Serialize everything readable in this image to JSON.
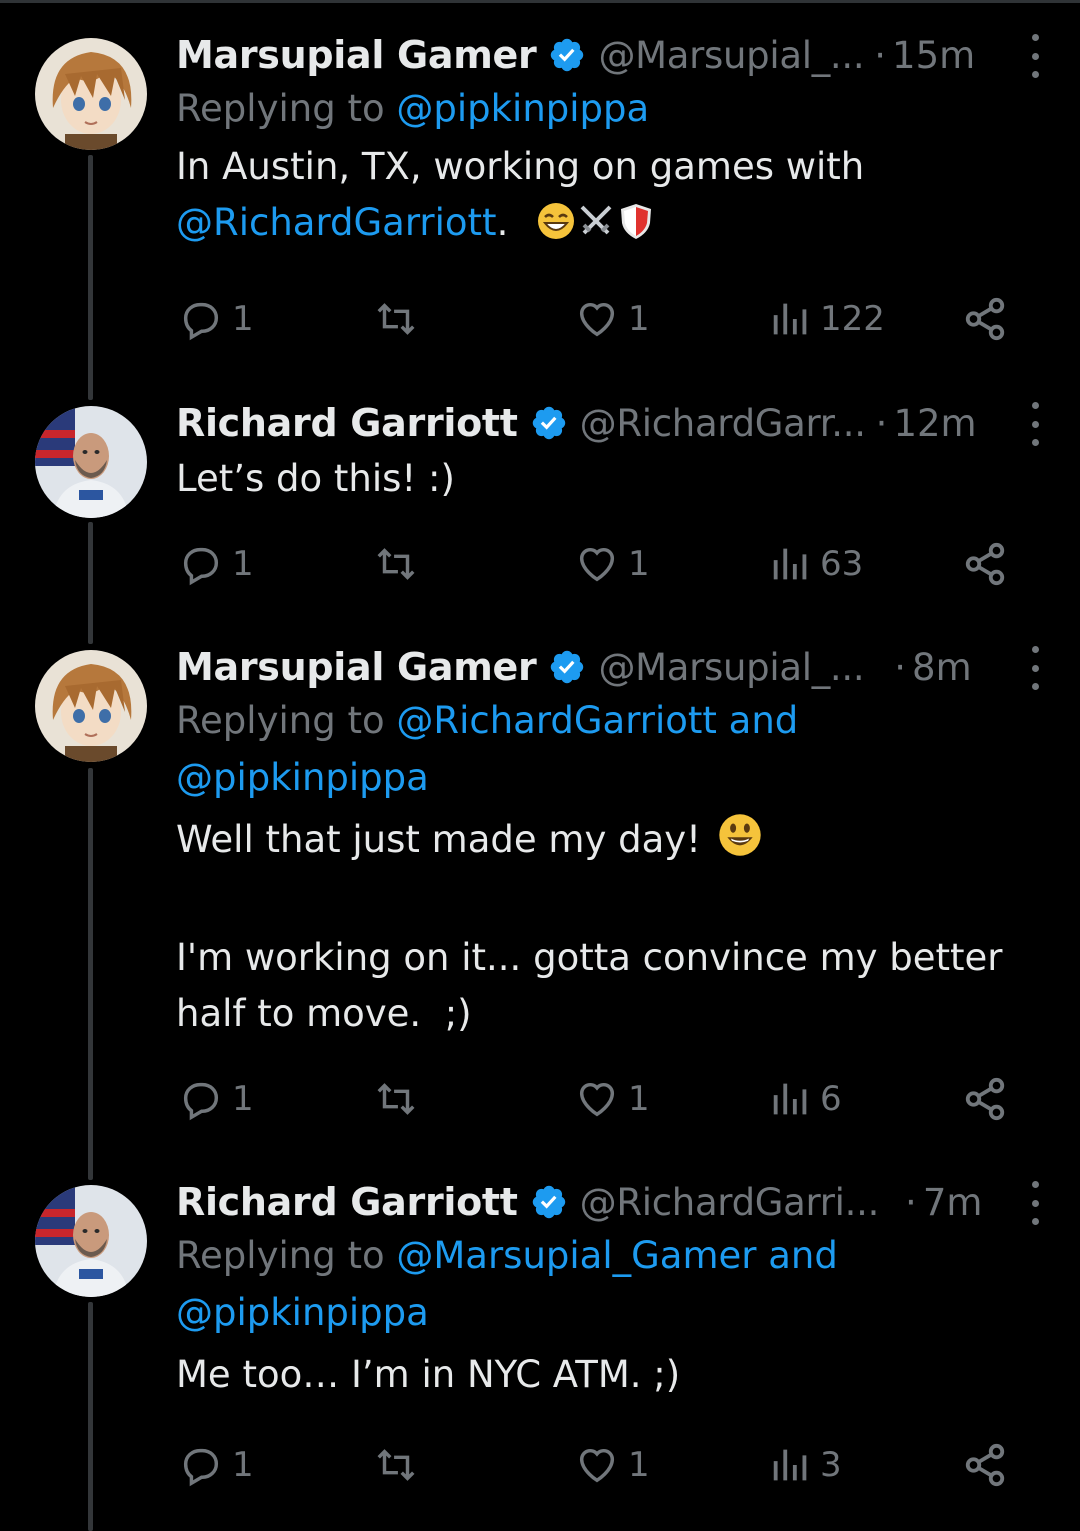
{
  "colors": {
    "background": "#000000",
    "text": "#e7e9ea",
    "muted": "#71767b",
    "link": "#1d9bf0",
    "verified": "#1d9bf0",
    "thread_line": "#333639"
  },
  "tweets": [
    {
      "name": "Marsupial Gamer",
      "handle": "@Marsupial_...",
      "time": "15m",
      "avatar": "anime-character-avatar",
      "reply_prefix": "Replying to ",
      "reply_links": [
        "@pipkinpippa"
      ],
      "reply_line2": "",
      "text_before_link": "In Austin, TX, working on games with",
      "mention": "@RichardGarriott",
      "text_after_mention": ".",
      "emojis": [
        "grinning-face-icon",
        "crossed-swords-icon",
        "shield-icon"
      ],
      "replies": "1",
      "retweets": "",
      "likes": "1",
      "views": "122"
    },
    {
      "name": "Richard Garriott",
      "handle": "@RichardGarr...",
      "time": "12m",
      "avatar": "astronaut-avatar",
      "text": "Let’s do this! :)",
      "replies": "1",
      "retweets": "",
      "likes": "1",
      "views": "63"
    },
    {
      "name": "Marsupial Gamer",
      "handle": "@Marsupial_...",
      "time": "8m",
      "avatar": "anime-character-avatar",
      "reply_prefix": "Replying to ",
      "reply_link1": "@RichardGarriott and",
      "reply_link2": "@pipkinpippa",
      "text_line1": "Well that just made my day!",
      "emoji": "smiley-face-icon",
      "text_line2": "I'm working on it... gotta convince my better",
      "text_line3": "half to move.  ;)",
      "replies": "1",
      "retweets": "",
      "likes": "1",
      "views": "6"
    },
    {
      "name": "Richard Garriott",
      "handle": "@RichardGarri...",
      "time": "7m",
      "avatar": "astronaut-avatar",
      "reply_prefix": "Replying to ",
      "reply_link1": "@Marsupial_Gamer and",
      "reply_link2": "@pipkinpippa",
      "text": "Me too… I’m in NYC ATM. ;)",
      "replies": "1",
      "retweets": "",
      "likes": "1",
      "views": "3"
    }
  ]
}
